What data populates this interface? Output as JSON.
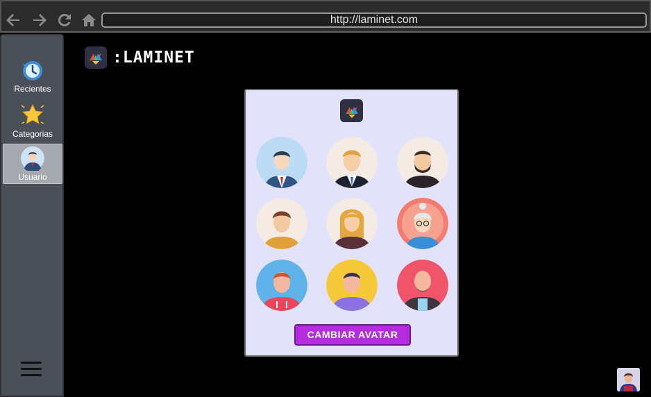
{
  "browser": {
    "url": "http://laminet.com",
    "back_icon": "arrow-left-icon",
    "forward_icon": "arrow-right-icon",
    "reload_icon": "reload-icon",
    "home_icon": "home-icon"
  },
  "sidebar": {
    "items": [
      {
        "label": "Recientes",
        "icon": "history-clock-icon",
        "active": false
      },
      {
        "label": "Categorias",
        "icon": "star-icon",
        "active": false
      },
      {
        "label": "Usuario",
        "icon": "user-avatar-icon",
        "active": true
      }
    ],
    "menu_icon": "hamburger-menu-icon"
  },
  "header": {
    "brand": ":LAMINET",
    "logo_icon": "crane-logo-icon"
  },
  "modal": {
    "logo_icon": "crane-logo-icon",
    "avatars": [
      {
        "name": "businessman-avatar"
      },
      {
        "name": "blonde-man-avatar"
      },
      {
        "name": "bearded-man-avatar"
      },
      {
        "name": "young-man-avatar"
      },
      {
        "name": "blonde-woman-avatar"
      },
      {
        "name": "grandmother-avatar"
      },
      {
        "name": "hoodie-man-avatar"
      },
      {
        "name": "purple-shirt-man-avatar"
      },
      {
        "name": "bald-bearded-man-avatar"
      }
    ],
    "button_label": "CAMBIAR AVATAR"
  },
  "colors": {
    "accent_button": "#b42ee0",
    "card_background": "#e3e2fb",
    "sidebar_background": "#4b5058"
  }
}
